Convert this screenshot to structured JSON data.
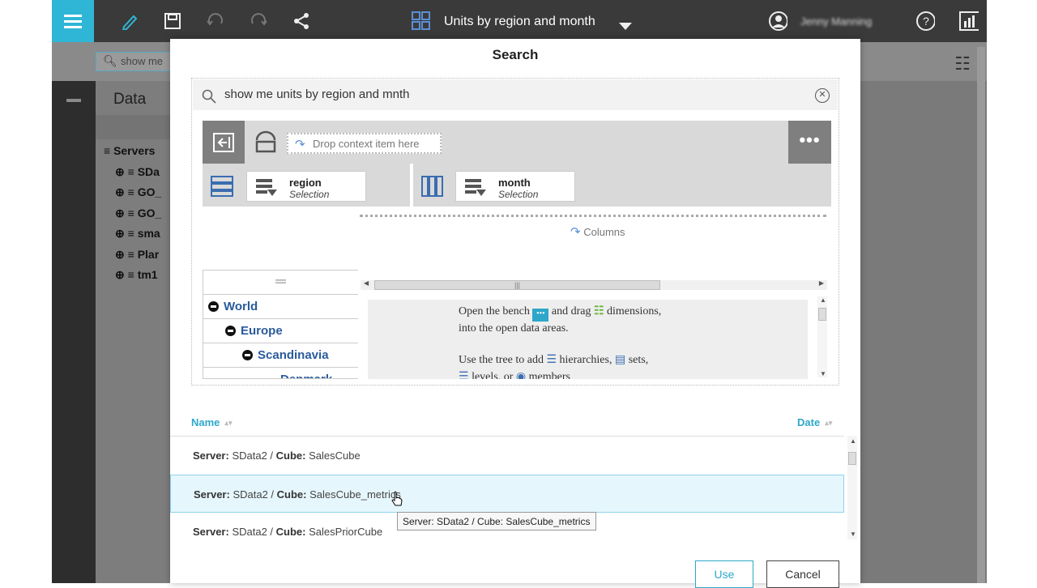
{
  "topbar": {
    "title": "Units by region and month",
    "user": "Jenny Manning",
    "icons": [
      "menu-icon",
      "pencil-icon",
      "save-icon",
      "undo-icon",
      "redo-icon",
      "share-icon",
      "dashboard-icon",
      "caret-down-icon",
      "user-icon",
      "help-icon",
      "chart-icon"
    ]
  },
  "background": {
    "search_value": "show me",
    "data_title": "Data",
    "servers_label": "Servers",
    "servers": [
      "SDa",
      "GO_",
      "GO_",
      "sma",
      "Plar",
      "tm1"
    ]
  },
  "dialog": {
    "title": "Search",
    "query": "show me units by region and mnth",
    "context_placeholder": "Drop context item here",
    "more_label": "•••",
    "rows_chip": {
      "name": "region",
      "sub": "Selection"
    },
    "cols_chip": {
      "name": "month",
      "sub": "Selection"
    },
    "columns_label": "Columns",
    "tree": [
      "World",
      "Europe",
      "Scandinavia",
      "Denmark"
    ],
    "instructions": {
      "line1a": "Open the bench",
      "line1b": "and drag",
      "line1c": "dimensions,",
      "line2": "into the open data areas.",
      "line3a": "Use the tree to add",
      "line3b": "hierarchies,",
      "line3c": "sets,",
      "line4a": "levels, or",
      "line4b": "members"
    },
    "col_name": "Name",
    "col_date": "Date",
    "results": [
      {
        "server_label": "Server:",
        "server": "SData2",
        "sep": " / ",
        "cube_label": "Cube:",
        "cube": "SalesCube"
      },
      {
        "server_label": "Server:",
        "server": "SData2",
        "sep": " / ",
        "cube_label": "Cube:",
        "cube": "SalesCube_metrics"
      },
      {
        "server_label": "Server:",
        "server": "SData2",
        "sep": " / ",
        "cube_label": "Cube:",
        "cube": "SalesPriorCube"
      }
    ],
    "tooltip": "Server: SData2 / Cube: SalesCube_metrics",
    "use_label": "Use",
    "cancel_label": "Cancel"
  }
}
